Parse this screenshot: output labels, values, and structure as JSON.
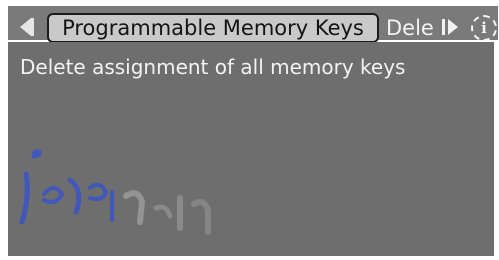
{
  "header": {
    "active_tab_label": "Programmable Memory Keys",
    "next_tab_label": "Dele",
    "prev_icon": "arrow-left-icon",
    "next_icon": "arrow-right-icon",
    "info_icon": "info-icon",
    "info_glyph": "i"
  },
  "content": {
    "description": "Delete assignment of all memory keys"
  },
  "watermark": {
    "text": "امداد خو",
    "color": "#3a55c8"
  },
  "colors": {
    "header_bg": "#7a7a7a",
    "content_bg": "#6e6e6e",
    "active_tab_bg": "#c9c9c9",
    "text_light": "#f2f2f2"
  }
}
